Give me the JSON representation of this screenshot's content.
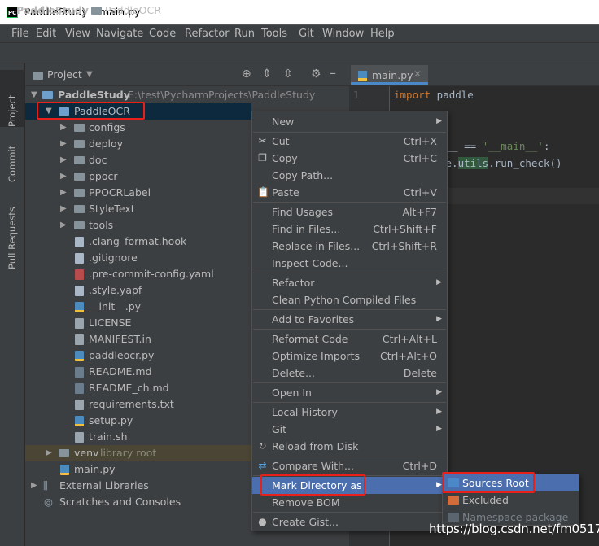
{
  "window": {
    "title": "PaddleStudy – main.py",
    "logo_text": "PC"
  },
  "menubar": [
    "File",
    "Edit",
    "View",
    "Navigate",
    "Code",
    "Refactor",
    "Run",
    "Tools",
    "Git",
    "Window",
    "Help"
  ],
  "breadcrumb": {
    "project": "PaddleStudy",
    "separator": "〉",
    "folder": "PaddleOCR"
  },
  "left_stripe": [
    "Project",
    "Commit",
    "Pull Requests"
  ],
  "project_panel": {
    "title": "Project",
    "root": {
      "name": "PaddleStudy",
      "path": "E:\\test\\PycharmProjects\\PaddleStudy"
    },
    "selected_folder": "PaddleOCR",
    "folders": [
      "configs",
      "deploy",
      "doc",
      "ppocr",
      "PPOCRLabel",
      "StyleText",
      "tools"
    ],
    "files": [
      ".clang_format.hook",
      ".gitignore",
      ".pre-commit-config.yaml",
      ".style.yapf",
      "__init__.py",
      "LICENSE",
      "MANIFEST.in",
      "paddleocr.py",
      "README.md",
      "README_ch.md",
      "requirements.txt",
      "setup.py",
      "train.sh"
    ],
    "venv": {
      "name": "venv",
      "tag": "library root"
    },
    "main_file": "main.py",
    "external": "External Libraries",
    "scratches": "Scratches and Consoles"
  },
  "editor": {
    "tab": "main.py",
    "line_number": "1",
    "lines": [
      {
        "kw": "import",
        "rest": " paddle"
      },
      {
        "text": "e__ == ",
        "str": "'__main__'",
        "tail": ":"
      },
      {
        "text": "le.",
        "hl": "utils",
        "tail": ".run_check()"
      }
    ]
  },
  "context_menu": {
    "items": [
      {
        "label": "New",
        "submenu": true
      },
      {
        "label": "Cut",
        "shortcut": "Ctrl+X",
        "icon": "scissors-icon"
      },
      {
        "label": "Copy",
        "shortcut": "Ctrl+C",
        "icon": "copy-icon"
      },
      {
        "label": "Copy Path...",
        "shortcut": ""
      },
      {
        "label": "Paste",
        "shortcut": "Ctrl+V",
        "icon": "paste-icon"
      },
      {
        "label": "Find Usages",
        "shortcut": "Alt+F7"
      },
      {
        "label": "Find in Files...",
        "shortcut": "Ctrl+Shift+F"
      },
      {
        "label": "Replace in Files...",
        "shortcut": "Ctrl+Shift+R"
      },
      {
        "label": "Inspect Code...",
        "shortcut": ""
      },
      {
        "label": "Refactor",
        "submenu": true
      },
      {
        "label": "Clean Python Compiled Files",
        "shortcut": ""
      },
      {
        "label": "Add to Favorites",
        "submenu": true
      },
      {
        "label": "Reformat Code",
        "shortcut": "Ctrl+Alt+L"
      },
      {
        "label": "Optimize Imports",
        "shortcut": "Ctrl+Alt+O"
      },
      {
        "label": "Delete...",
        "shortcut": "Delete"
      },
      {
        "label": "Open In",
        "submenu": true
      },
      {
        "label": "Local History",
        "submenu": true
      },
      {
        "label": "Git",
        "submenu": true
      },
      {
        "label": "Reload from Disk",
        "shortcut": "",
        "icon": "reload-icon"
      },
      {
        "label": "Compare With...",
        "shortcut": "Ctrl+D",
        "icon": "compare-icon"
      },
      {
        "label": "Mark Directory as",
        "submenu": true,
        "selected": true
      },
      {
        "label": "Remove BOM",
        "shortcut": ""
      },
      {
        "label": "Create Gist...",
        "shortcut": "",
        "icon": "github-icon"
      }
    ]
  },
  "submenu": {
    "items": [
      {
        "label": "Sources Root",
        "selected": true,
        "color": "#4a88c7"
      },
      {
        "label": "Excluded",
        "color": "#d36b3a"
      },
      {
        "label": "Namespace package",
        "disabled": true,
        "color": "#6b7680"
      }
    ]
  },
  "watermark": "https://blog.csdn.net/fm0517",
  "colors": {
    "accent": "#4b6eaf",
    "highlight_box": "#e8201a",
    "background": "#2b2b2b",
    "panel": "#3c3f41"
  }
}
